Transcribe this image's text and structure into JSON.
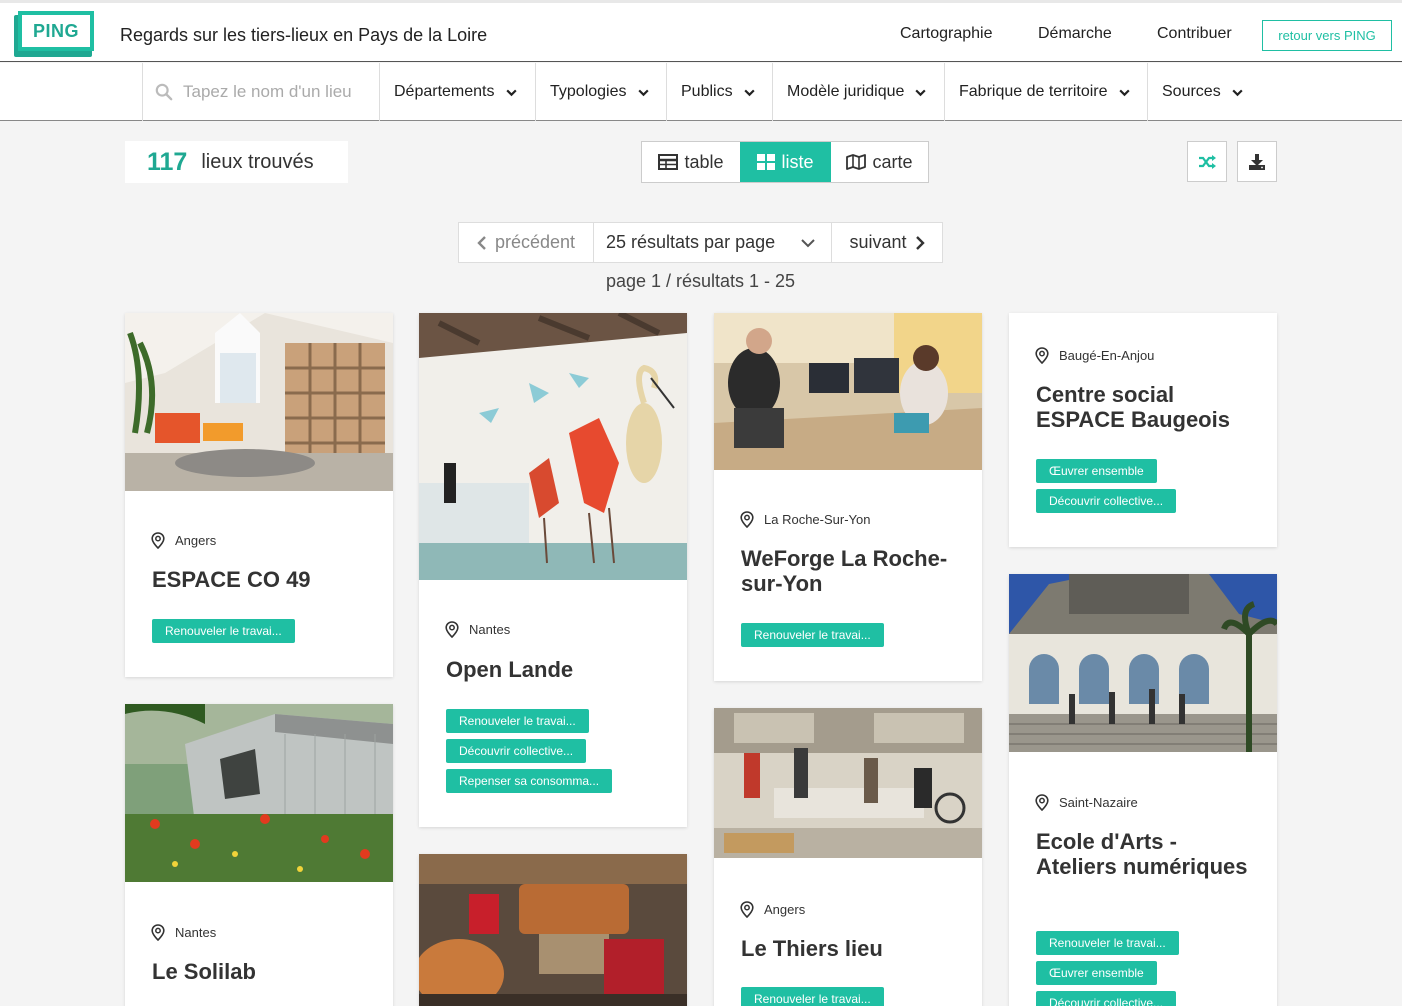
{
  "header": {
    "logo_text": "PING",
    "site_title": "Regards sur les tiers-lieux en Pays de la Loire",
    "nav": [
      "Cartographie",
      "Démarche",
      "Contribuer"
    ],
    "back_button": "retour vers PING"
  },
  "filters": {
    "search_placeholder": "Tapez le nom d'un lieu",
    "items": [
      "Départements",
      "Typologies",
      "Publics",
      "Modèle juridique",
      "Fabrique de territoire",
      "Sources"
    ]
  },
  "toolbar": {
    "count": "117",
    "count_label": "lieux trouvés",
    "views": [
      "table",
      "liste",
      "carte"
    ],
    "active_view": "liste"
  },
  "pagination": {
    "prev": "précédent",
    "per_page": "25 résultats par page",
    "next": "suivant",
    "info": "page 1 / résultats 1 - 25"
  },
  "colors": {
    "accent": "#1fbfa3",
    "accent_dark": "#1fa892",
    "background": "#f4f4f4"
  },
  "cards": [
    {
      "city": "Angers",
      "name": "ESPACE CO 49",
      "tags": [
        "Renouveler le travai..."
      ]
    },
    {
      "city": "Nantes",
      "name": "Le Solilab",
      "tags": []
    },
    {
      "city": "Nantes",
      "name": "Open Lande",
      "tags": [
        "Renouveler le travai...",
        "Découvrir collective...",
        "Repenser sa consomma..."
      ]
    },
    {
      "city": "La Roche-Sur-Yon",
      "name": "WeForge La Roche-sur-Yon",
      "tags": [
        "Renouveler le travai..."
      ]
    },
    {
      "city": "Angers",
      "name": "Le Thiers lieu",
      "tags": [
        "Renouveler le travai..."
      ]
    },
    {
      "city": "Baugé-En-Anjou",
      "name": "Centre social ESPACE Baugeois",
      "tags": [
        "Œuvrer ensemble",
        "Découvrir collective..."
      ]
    },
    {
      "city": "Saint-Nazaire",
      "name": "Ecole d'Arts - Ateliers numériques",
      "tags": [
        "Renouveler le travai...",
        "Œuvrer ensemble",
        "Découvrir collective..."
      ]
    }
  ]
}
